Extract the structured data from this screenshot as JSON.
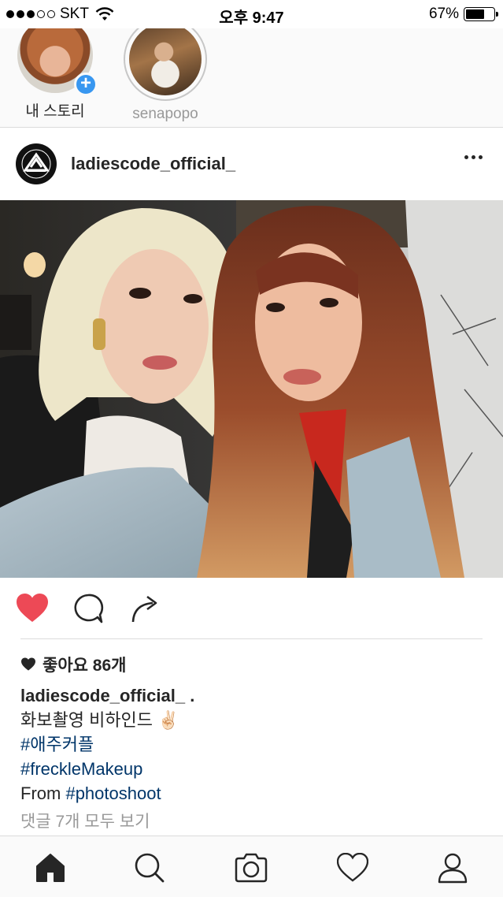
{
  "status_bar": {
    "carrier": "SKT",
    "time": "오후 9:47",
    "battery_text": "67%",
    "battery_level": 0.67,
    "signal_bars_filled": 3,
    "signal_bars_total": 5
  },
  "stories": [
    {
      "label": "내 스토리",
      "icon": "add-story-plus"
    },
    {
      "label": "senapopo"
    }
  ],
  "post": {
    "username": "ladiescode_official_",
    "liked": true,
    "likes_text": "좋아요 86개",
    "caption_user": "ladiescode_official_ .",
    "caption_lines": [
      {
        "text": "화보촬영 비하인드 ✌🏻",
        "type": "text"
      },
      {
        "text": "#애주커플",
        "type": "tag"
      },
      {
        "text": "#freckleMakeup",
        "type": "tag"
      }
    ],
    "from_prefix": "From ",
    "from_tag": "#photoshoot",
    "comments_link": "댓글 7개 모두 보기"
  },
  "colors": {
    "like_red": "#ed4956",
    "tag_blue": "#003569",
    "plus_blue": "#3897f0",
    "muted_gray": "#999999"
  },
  "tab_bar": [
    "home-icon",
    "search-icon",
    "camera-icon",
    "heart-icon",
    "profile-icon"
  ]
}
